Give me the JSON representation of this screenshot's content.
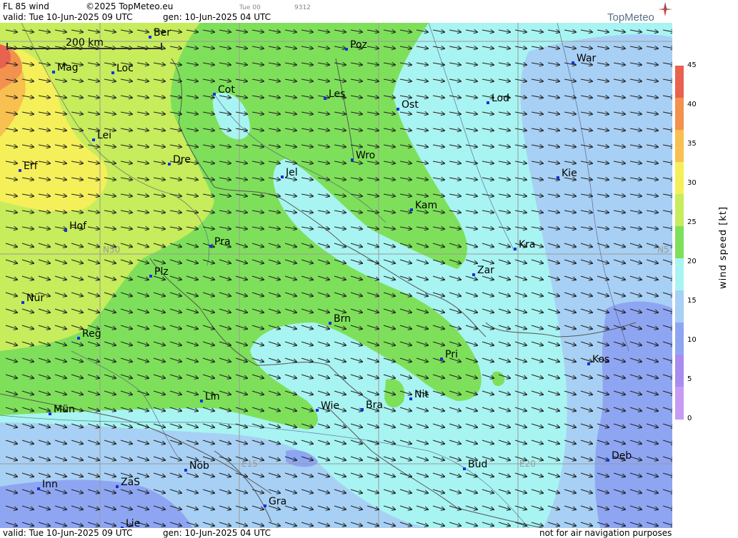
{
  "header": {
    "product": "FL 85 wind",
    "copyright": "©2025 TopMeteo.eu",
    "frame": "Tue 00",
    "code": "9312",
    "valid": "valid:  Tue  10-Jun-2025  09 UTC",
    "gen": "gen: 10-Jun-2025 04 UTC",
    "logo_text": "TopMeteo"
  },
  "footer": {
    "valid": "valid:  Tue  10-Jun-2025  09 UTC",
    "gen": "gen: 10-Jun-2025 04 UTC",
    "notice": "not for air navigation purposes"
  },
  "scale_bar": "200 km",
  "grid_labels": [
    "N50",
    "N5",
    "E15",
    "E20"
  ],
  "legend": {
    "title": "wind  speed  [kt]",
    "ticks": [
      "45",
      "40",
      "35",
      "30",
      "25",
      "20",
      "15",
      "10",
      "5",
      "0"
    ],
    "colors": [
      "#e8624f",
      "#f2924e",
      "#f8c050",
      "#f5ef5a",
      "#c7ec5c",
      "#7ee05a",
      "#a8f4f2",
      "#a8d0f4",
      "#8ea6f2",
      "#a98cf0",
      "#c79bf2"
    ]
  },
  "cities": [
    {
      "name": "Ber"
    },
    {
      "name": "Poz"
    },
    {
      "name": "War"
    },
    {
      "name": "Mag"
    },
    {
      "name": "Loc"
    },
    {
      "name": "Cot"
    },
    {
      "name": "Les"
    },
    {
      "name": "Ost"
    },
    {
      "name": "Lod"
    },
    {
      "name": "Lei"
    },
    {
      "name": "Dre"
    },
    {
      "name": "Wro"
    },
    {
      "name": "Erf"
    },
    {
      "name": "Jel"
    },
    {
      "name": "Kie"
    },
    {
      "name": "Kam"
    },
    {
      "name": "Hof"
    },
    {
      "name": "Pra"
    },
    {
      "name": "Kra"
    },
    {
      "name": "Zar"
    },
    {
      "name": "Plz"
    },
    {
      "name": "Nür"
    },
    {
      "name": "Brn"
    },
    {
      "name": "Reg"
    },
    {
      "name": "Pri"
    },
    {
      "name": "Kos"
    },
    {
      "name": "Lin"
    },
    {
      "name": "Nit"
    },
    {
      "name": "Mün"
    },
    {
      "name": "Wie"
    },
    {
      "name": "Bra"
    },
    {
      "name": "Deb"
    },
    {
      "name": "Nöb"
    },
    {
      "name": "Bud"
    },
    {
      "name": "Inn"
    },
    {
      "name": "ZaS"
    },
    {
      "name": "Gra"
    },
    {
      "name": "Lie"
    }
  ]
}
